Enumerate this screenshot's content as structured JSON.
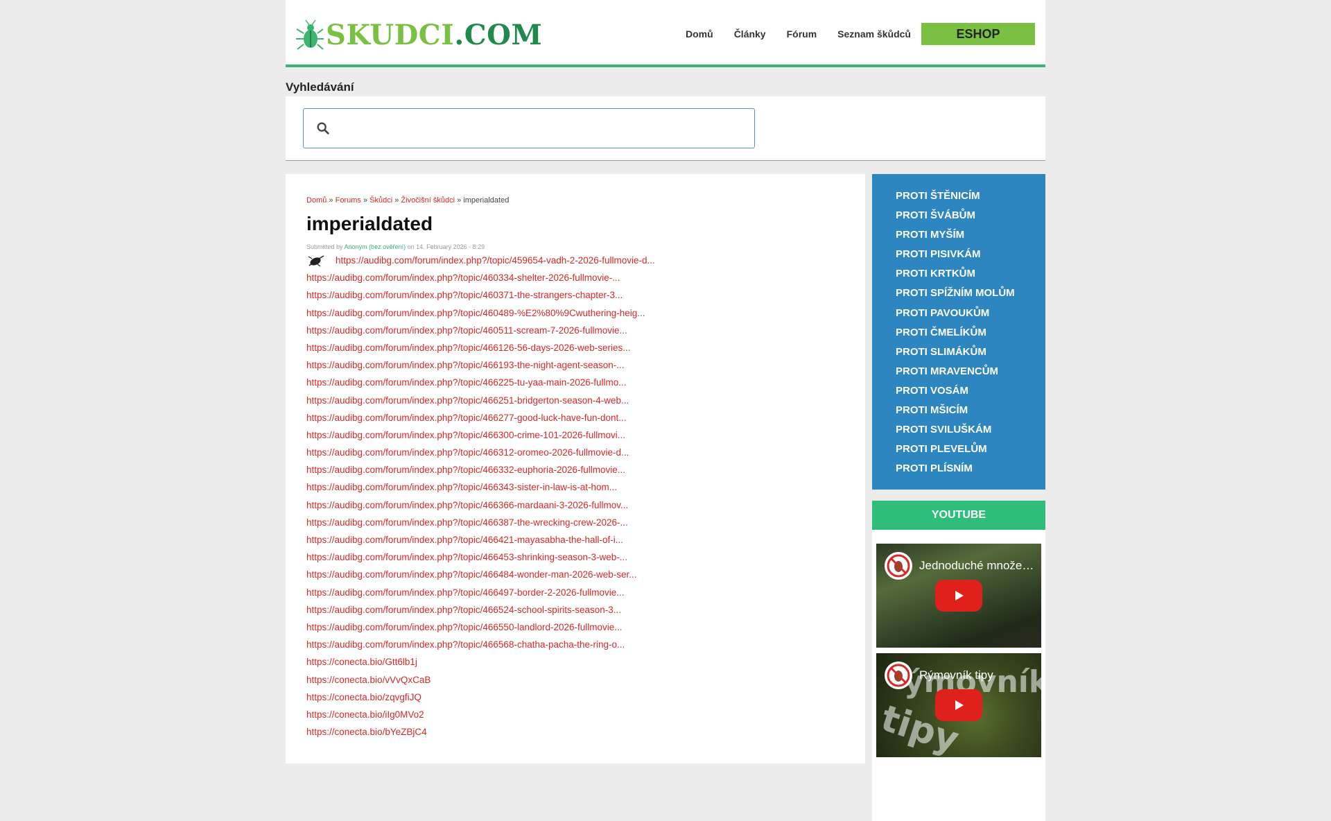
{
  "header": {
    "logo_part1": "SKUDCI",
    "logo_part2": ".COM",
    "nav": [
      "Domů",
      "Články",
      "Fórum",
      "Seznam škůdců"
    ],
    "eshop": "ESHOP"
  },
  "search": {
    "title": "Vyhledávání",
    "value": ""
  },
  "breadcrumb": {
    "items": [
      "Domů",
      "Forums",
      "Škůdci",
      "Živočišní škůdci"
    ],
    "current": "imperialdated",
    "separator": "»"
  },
  "node": {
    "title": "imperialdated",
    "submitted_prefix": "Submitted by",
    "author": "Anonym (bez ověření)",
    "submitted_suffix": "on 14. February 2026 - 8:29"
  },
  "links": [
    "https://audibg.com/forum/index.php?/topic/459654-vadh-2-2026-fullmovie-d...",
    "https://audibg.com/forum/index.php?/topic/460334-shelter-2026-fullmovie-...",
    "https://audibg.com/forum/index.php?/topic/460371-the-strangers-chapter-3...",
    "https://audibg.com/forum/index.php?/topic/460489-%E2%80%9Cwuthering-heig...",
    "https://audibg.com/forum/index.php?/topic/460511-scream-7-2026-fullmovie...",
    "https://audibg.com/forum/index.php?/topic/466126-56-days-2026-web-series...",
    "https://audibg.com/forum/index.php?/topic/466193-the-night-agent-season-...",
    "https://audibg.com/forum/index.php?/topic/466225-tu-yaa-main-2026-fullmo...",
    "https://audibg.com/forum/index.php?/topic/466251-bridgerton-season-4-web...",
    "https://audibg.com/forum/index.php?/topic/466277-good-luck-have-fun-dont...",
    "https://audibg.com/forum/index.php?/topic/466300-crime-101-2026-fullmovi...",
    "https://audibg.com/forum/index.php?/topic/466312-oromeo-2026-fullmovie-d...",
    "https://audibg.com/forum/index.php?/topic/466332-euphoria-2026-fullmovie...",
    "https://audibg.com/forum/index.php?/topic/466343-sister-in-law-is-at-hom...",
    "https://audibg.com/forum/index.php?/topic/466366-mardaani-3-2026-fullmov...",
    "https://audibg.com/forum/index.php?/topic/466387-the-wrecking-crew-2026-...",
    "https://audibg.com/forum/index.php?/topic/466421-mayasabha-the-hall-of-i...",
    "https://audibg.com/forum/index.php?/topic/466453-shrinking-season-3-web-...",
    "https://audibg.com/forum/index.php?/topic/466484-wonder-man-2026-web-ser...",
    "https://audibg.com/forum/index.php?/topic/466497-border-2-2026-fullmovie...",
    "https://audibg.com/forum/index.php?/topic/466524-school-spirits-season-3...",
    "https://audibg.com/forum/index.php?/topic/466550-landlord-2026-fullmovie...",
    "https://audibg.com/forum/index.php?/topic/466568-chatha-pacha-the-ring-o...",
    "https://conecta.bio/Gtt6lb1j",
    "https://conecta.bio/vVvQxCaB",
    "https://conecta.bio/zqvgfiJQ",
    "https://conecta.bio/iIg0MVo2",
    "https://conecta.bio/bYeZBjC4"
  ],
  "sidebar": {
    "menu": [
      "PROTI ŠTĚNICÍM",
      "PROTI ŠVÁBŮM",
      "PROTI MYŠÍM",
      "PROTI PISIVKÁM",
      "PROTI KRTKŮM",
      "PROTI SPÍŽNÍM MOLŮM",
      "PROTI PAVOUKŮM",
      "PROTI ČMELÍKŮM",
      "PROTI SLIMÁKŮM",
      "PROTI MRAVENCŮM",
      "PROTI VOSÁM",
      "PROTI MŠICÍM",
      "PROTI SVILUŠKÁM",
      "PROTI PLEVELŮM",
      "PROTI PLÍSNÍM"
    ],
    "youtube_title": "YOUTUBE",
    "videos": [
      {
        "title": "Jednoduché množení ..."
      },
      {
        "title": "Rýmovník tipy",
        "thumb_text1": "ýmovník",
        "thumb_text2": "tipy"
      }
    ]
  },
  "colors": {
    "accent_green": "#7ac143",
    "link_red": "#d62828",
    "sidebar_blue": "#2e86c1",
    "youtube_green": "#2ebd7b"
  }
}
